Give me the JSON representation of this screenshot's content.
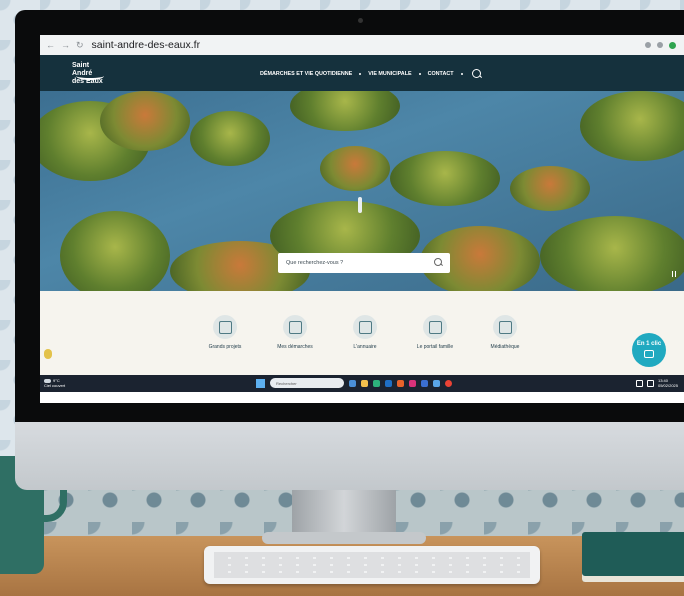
{
  "browser": {
    "url": "saint-andre-des-eaux.fr"
  },
  "site": {
    "logo_text_line1": "Saint André",
    "logo_text_line2": "des Eaux",
    "nav": [
      "DÉMARCHES ET VIE QUOTIDIENNE",
      "VIE MUNICIPALE",
      "CONTACT"
    ],
    "search_placeholder": "Que recherchez-vous ?"
  },
  "quick_links": [
    {
      "label": "Grands projets",
      "icon": "building-icon"
    },
    {
      "label": "Mes démarches",
      "icon": "clipboard-icon"
    },
    {
      "label": "L'annuaire",
      "icon": "book-icon"
    },
    {
      "label": "Le portail famille",
      "icon": "family-icon"
    },
    {
      "label": "Médiathèque",
      "icon": "library-icon"
    }
  ],
  "en1clic": {
    "label": "En 1 clic"
  },
  "taskbar": {
    "weather_temp": "9°C",
    "weather_desc": "Ciel couvert",
    "search_label": "Rechercher",
    "time": "13:40",
    "date": "05/02/2025"
  },
  "colors": {
    "header": "#15313d",
    "accent": "#20a9c0",
    "taskbar": "#1b2330"
  }
}
